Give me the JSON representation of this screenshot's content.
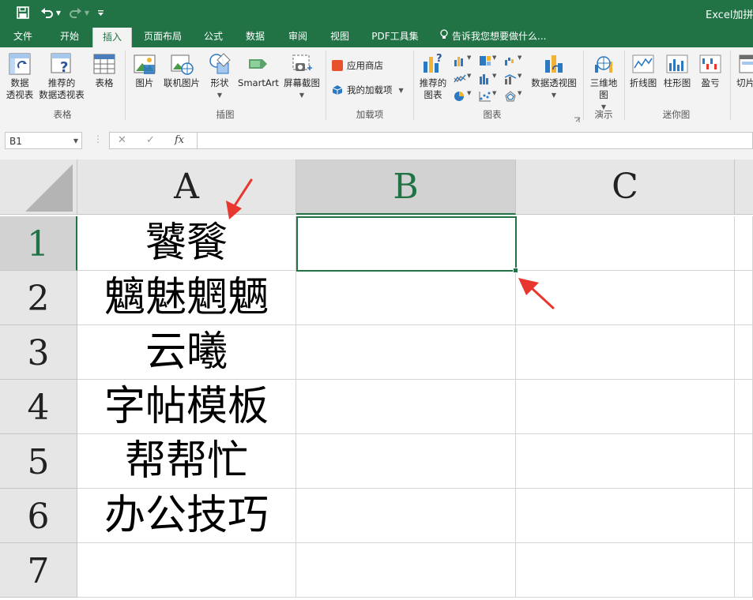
{
  "title_bar": {
    "doc_title": "Excel加拼音",
    "qat": {
      "save_icon": "save-icon",
      "undo_icon": "undo-icon",
      "redo_icon": "redo-icon",
      "customize_icon": "chevron-down-icon"
    }
  },
  "tabs": [
    {
      "label": "文件"
    },
    {
      "label": "开始"
    },
    {
      "label": "插入",
      "active": true
    },
    {
      "label": "页面布局"
    },
    {
      "label": "公式"
    },
    {
      "label": "数据"
    },
    {
      "label": "审阅"
    },
    {
      "label": "视图"
    },
    {
      "label": "PDF工具集"
    }
  ],
  "tell_me": "告诉我您想要做什么...",
  "ribbon": {
    "tables": {
      "label": "表格",
      "pivot_line1": "数据",
      "pivot_line2": "透视表",
      "rec_pivot_line1": "推荐的",
      "rec_pivot_line2": "数据透视表",
      "table": "表格"
    },
    "illustrations": {
      "label": "插图",
      "picture": "图片",
      "online_picture": "联机图片",
      "shapes": "形状",
      "smartart": "SmartArt",
      "screenshot": "屏幕截图"
    },
    "addins": {
      "label": "加载项",
      "store": "应用商店",
      "my_addins": "我的加载项"
    },
    "charts": {
      "label": "图表",
      "recommended_line1": "推荐的",
      "recommended_line2": "图表",
      "pivot_chart": "数据透视图"
    },
    "tours": {
      "label": "演示",
      "map_line1": "三维地",
      "map_line2": "图"
    },
    "sparklines": {
      "label": "迷你图",
      "line": "折线图",
      "column": "柱形图",
      "winloss": "盈亏"
    },
    "filters": {
      "slicer": "切片"
    }
  },
  "formula_bar": {
    "name_box": "B1",
    "cancel": "✕",
    "enter": "✓",
    "fx": "fx",
    "value": ""
  },
  "sheet": {
    "columns": [
      "A",
      "B",
      "C"
    ],
    "selected_column": "B",
    "rows": [
      "1",
      "2",
      "3",
      "4",
      "5",
      "6",
      "7"
    ],
    "selected_row": "1",
    "cells_a": [
      "饕餮",
      "魑魅魍魉",
      "云曦",
      "字帖模板",
      "帮帮忙",
      "办公技巧",
      ""
    ],
    "active_cell": "B1"
  },
  "colors": {
    "accent": "#217346",
    "arrow": "#e8372f"
  }
}
